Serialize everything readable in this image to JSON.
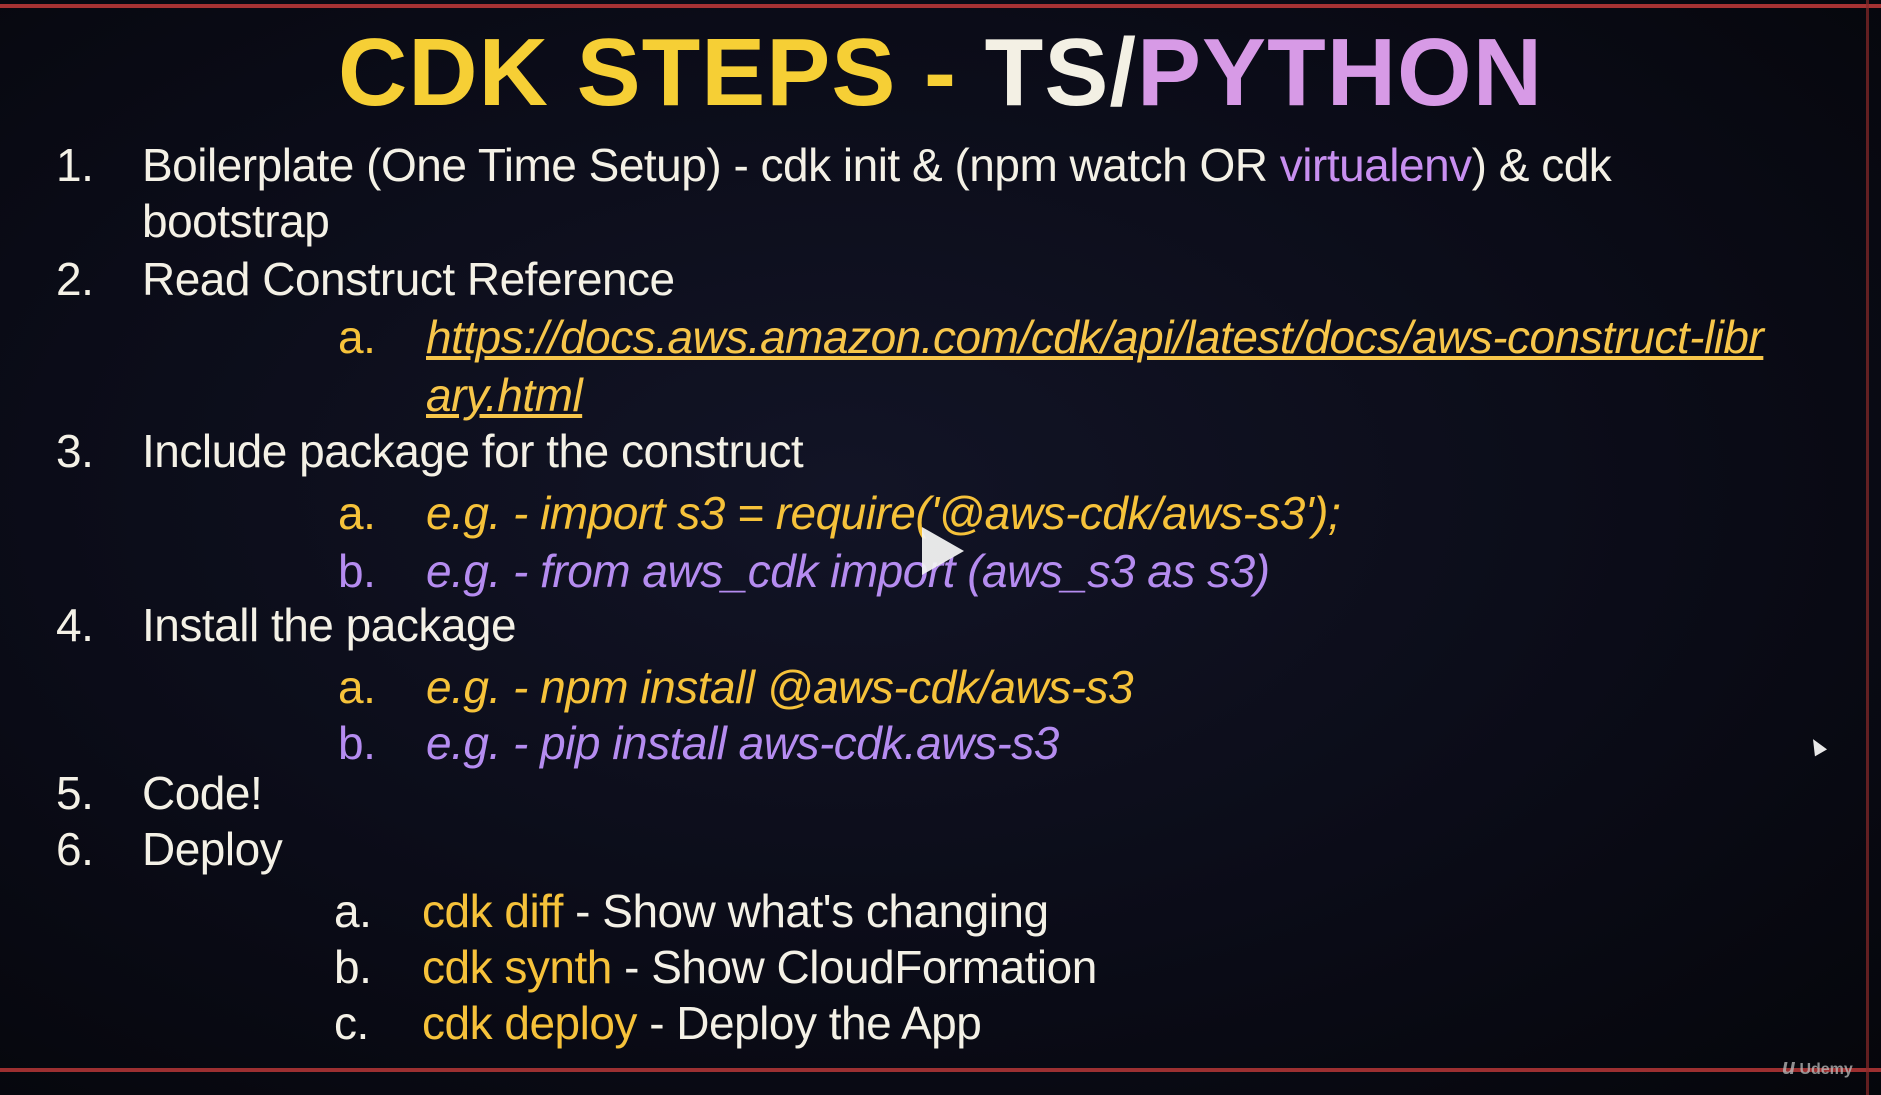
{
  "title": {
    "part1": "CDK STEPS - ",
    "part2": "TS/",
    "part3": "PYTHON"
  },
  "steps": [
    {
      "num": "1.",
      "line1_a": "Boilerplate (One Time Setup) - cdk init & (npm watch OR ",
      "line1_b": "virtualenv",
      "line1_c": ") & cdk",
      "line2": "bootstrap"
    },
    {
      "num": "2.",
      "text": "Read Construct Reference",
      "sub": [
        {
          "letter": "a.",
          "link_line1": "https://docs.aws.amazon.com/cdk/api/latest/docs/aws-construct-libr",
          "link_line2": "ary.html"
        }
      ]
    },
    {
      "num": "3.",
      "text": "Include package for the construct",
      "sub": [
        {
          "letter": "a.",
          "text": "e.g. - import s3 =  require('@aws-cdk/aws-s3');"
        },
        {
          "letter": "b.",
          "text": "e.g. - from aws_cdk import (aws_s3 as s3)"
        }
      ]
    },
    {
      "num": "4.",
      "text": "Install the package",
      "sub": [
        {
          "letter": "a.",
          "text": "e.g. - npm install @aws-cdk/aws-s3"
        },
        {
          "letter": "b.",
          "text": "e.g. - pip install aws-cdk.aws-s3"
        }
      ]
    },
    {
      "num": "5.",
      "text": "Code!"
    },
    {
      "num": "6.",
      "text": "Deploy",
      "sub": [
        {
          "letter": "a.",
          "cmd": "cdk diff",
          "desc": " - Show what's changing"
        },
        {
          "letter": "b.",
          "cmd": "cdk synth",
          "desc": " - Show CloudFormation"
        },
        {
          "letter": "c.",
          "cmd": "cdk deploy",
          "desc": " - Deploy the App"
        }
      ]
    }
  ],
  "watermark": {
    "logo": "u",
    "text": "Udemy"
  },
  "colors": {
    "yellow": "#f6cf35",
    "purple": "#d79ae6",
    "white": "#f3f0e4",
    "link": "#f7c64a"
  },
  "icons": {
    "play": "play-icon",
    "cursor": "cursor-icon"
  }
}
